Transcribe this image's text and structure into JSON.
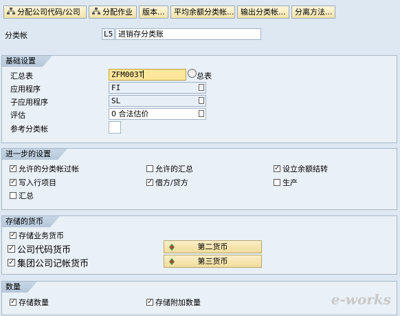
{
  "toolbar": {
    "btn1": "分配公司代码/公司",
    "btn2": "分配作业",
    "btn3": "版本...",
    "btn4": "平均余额分类帐...",
    "btn5": "输出分类帐...",
    "btn6": "分离方法..."
  },
  "ledger": {
    "label": "分类帐",
    "code": "L5",
    "name": "进销存分类账"
  },
  "basic": {
    "title": "基础设置",
    "summary_label": "汇总表",
    "summary_value": "ZFM003T",
    "summary_suffix": "总表",
    "app_label": "应用程序",
    "app_value": "FI",
    "subapp_label": "子应用程序",
    "subapp_value": "SL",
    "valuation_label": "评估",
    "valuation_value": "0 合法估价",
    "ref_label": "参考分类帐",
    "ref_value": ""
  },
  "further": {
    "title": "进一步的设置",
    "allowed_ledgers": "允许的分类帐过帐",
    "allowed_summary": "允许的汇总",
    "balance_carry": "设立余额结转",
    "write_line": "写入行项目",
    "debit_credit": "借方/贷方",
    "production": "生产",
    "summary": "汇总"
  },
  "currencies": {
    "title": "存储的货币",
    "store_trans": "存储业务货币",
    "company_code_currency": "公司代码货币",
    "group_currency": "集团公司记帐货币",
    "second_currency_btn": "第二货币",
    "third_currency_btn": "第三货币"
  },
  "quantity": {
    "title": "数量",
    "store_qty": "存储数量",
    "store_add_qty": "存储附加数量"
  },
  "watermark": "e-works"
}
